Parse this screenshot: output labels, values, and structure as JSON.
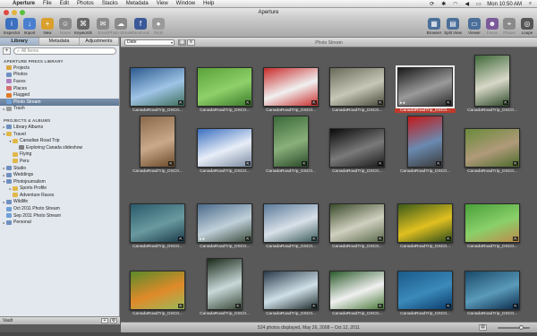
{
  "menubar": {
    "apple": "",
    "items": [
      "Aperture",
      "File",
      "Edit",
      "Photos",
      "Stacks",
      "Metadata",
      "View",
      "Window",
      "Help"
    ],
    "clock": "Mon 10:50 AM"
  },
  "window": {
    "title": "Aperture"
  },
  "toolbar": {
    "left": [
      {
        "label": "Inspector",
        "icon": "info-icon",
        "color": "#3b6fbf",
        "glyph": "i"
      },
      {
        "label": "Import",
        "icon": "import-icon",
        "color": "#4a7fd0",
        "glyph": "↓"
      },
      {
        "label": "New",
        "icon": "new-icon",
        "color": "#d9a02c",
        "glyph": "+"
      },
      {
        "label": "Name",
        "icon": "name-icon",
        "color": "#8a8a8a",
        "glyph": "☺",
        "dim": true
      },
      {
        "label": "Keywords",
        "icon": "keywords-icon",
        "color": "#666",
        "glyph": "⌘"
      },
      {
        "label": "Email",
        "icon": "email-icon",
        "color": "#8a8a8a",
        "glyph": "✉",
        "dim": true
      },
      {
        "label": "Photo Stream",
        "icon": "photo-stream-icon",
        "color": "#8a8a8a",
        "glyph": "☁",
        "dim": true
      },
      {
        "label": "Facebook",
        "icon": "facebook-icon",
        "color": "#3b5998",
        "glyph": "f",
        "dim": true
      },
      {
        "label": "Flickr",
        "icon": "flickr-icon",
        "color": "#9a9a9a",
        "glyph": "●",
        "dim": true
      }
    ],
    "right": [
      {
        "label": "Browser",
        "icon": "browser-icon",
        "color": "#4b6f99",
        "glyph": "▦"
      },
      {
        "label": "Split View",
        "icon": "split-view-icon",
        "color": "#4b6f99",
        "glyph": "▤"
      },
      {
        "label": "Viewer",
        "icon": "viewer-icon",
        "color": "#4b6f99",
        "glyph": "▭"
      },
      {
        "label": "Faces",
        "icon": "faces-icon",
        "color": "#7a5a99",
        "glyph": "☻",
        "dim": true
      },
      {
        "label": "Places",
        "icon": "places-icon",
        "color": "#8a8a8a",
        "glyph": "⌖",
        "dim": true
      },
      {
        "label": "Loupe",
        "icon": "loupe-icon",
        "color": "#555",
        "glyph": "◎"
      }
    ]
  },
  "inspector": {
    "tabs": [
      "Library",
      "Metadata",
      "Adjustments"
    ],
    "search_placeholder": "All Items",
    "library_heading": "APERTURE PRESS LIBRARY",
    "projects_heading": "PROJECTS & ALBUMS",
    "library_items": [
      {
        "label": "Projects",
        "color": "#d9a441"
      },
      {
        "label": "Photos",
        "color": "#6f8fbf"
      },
      {
        "label": "Faces",
        "color": "#b07fbf"
      },
      {
        "label": "Places",
        "color": "#d36f6f"
      },
      {
        "label": "Flagged",
        "color": "#e07a2a"
      },
      {
        "label": "Photo Stream",
        "color": "#6fa0d8",
        "selected": true
      },
      {
        "label": "Trash",
        "color": "#9a9a9a",
        "tri": "▸"
      }
    ],
    "project_items": [
      {
        "label": "Library Albums",
        "indent": 0,
        "tri": "▸",
        "color": "#6f8fbf"
      },
      {
        "label": "Travel",
        "indent": 0,
        "tri": "▾",
        "color": "#e0b84a"
      },
      {
        "label": "Canadian Road Trip",
        "indent": 1,
        "tri": "▾",
        "color": "#e0b84a"
      },
      {
        "label": "Exploring Canada slideshow",
        "indent": 2,
        "tri": "",
        "color": "#7f7f7f"
      },
      {
        "label": "Flying",
        "indent": 1,
        "tri": "",
        "color": "#e0b84a"
      },
      {
        "label": "Peru",
        "indent": 1,
        "tri": "",
        "color": "#e0b84a"
      },
      {
        "label": "Studio",
        "indent": 0,
        "tri": "▸",
        "color": "#6f8fbf"
      },
      {
        "label": "Weddings",
        "indent": 0,
        "tri": "▸",
        "color": "#6f8fbf"
      },
      {
        "label": "Photojournalism",
        "indent": 0,
        "tri": "▾",
        "color": "#6f8fbf"
      },
      {
        "label": "Sports Profile",
        "indent": 1,
        "tri": "▸",
        "color": "#e0b84a"
      },
      {
        "label": "Adventure Races",
        "indent": 1,
        "tri": "",
        "color": "#e0b84a"
      },
      {
        "label": "Wildlife",
        "indent": 0,
        "tri": "▸",
        "color": "#6f8fbf"
      },
      {
        "label": "Oct 2011 Photo Stream",
        "indent": 0,
        "tri": "",
        "color": "#6fa0d8"
      },
      {
        "label": "Sep 2011 Photo Stream",
        "indent": 0,
        "tri": "",
        "color": "#6fa0d8"
      },
      {
        "label": "Personal",
        "indent": 0,
        "tri": "▸",
        "color": "#6f8fbf"
      }
    ],
    "footer_label": "Vault"
  },
  "browser": {
    "sort_label": "Date",
    "title": "Photo Stream",
    "status": "524 photos displayed, May 26, 2008 – Oct 12, 2011",
    "photos": [
      {
        "caption": "CanadaRoadTrip_DSC0...",
        "colors": [
          "#2c5a8f",
          "#9fc4e6",
          "#3f6f5a"
        ],
        "row": 0,
        "col": 0,
        "w": 62,
        "h": 44
      },
      {
        "caption": "CanadaRoadTrip_DSC0...",
        "colors": [
          "#5aa23a",
          "#8fd06a",
          "#3a7a2a"
        ],
        "row": 0,
        "col": 1,
        "w": 62,
        "h": 44
      },
      {
        "caption": "CanadaRoadTrip_DSC0...",
        "colors": [
          "#c92b2b",
          "#f0f0f0",
          "#c92b2b"
        ],
        "row": 0,
        "col": 2,
        "w": 62,
        "h": 44
      },
      {
        "caption": "CanadaRoadTrip_DSC0...",
        "colors": [
          "#6a6a5a",
          "#c7c7b8",
          "#4a4a3a"
        ],
        "row": 0,
        "col": 3,
        "w": 62,
        "h": 44
      },
      {
        "caption": "CanadaRoadTrip_DSC0...",
        "colors": [
          "#1a1a1a",
          "#9a9a9a",
          "#2a2a2a"
        ],
        "row": 0,
        "col": 4,
        "w": 62,
        "h": 44,
        "selected": true,
        "stars": "★★"
      },
      {
        "caption": "CanadaRoadTrip_DSC0...",
        "colors": [
          "#3f6a3a",
          "#d8d8c8",
          "#2f4a2a"
        ],
        "row": 0,
        "col": 5,
        "w": 40,
        "h": 58
      },
      {
        "caption": "CanadaRoadTrip_DSC0...",
        "colors": [
          "#8a6a4a",
          "#c9a98a",
          "#6a4a2a"
        ],
        "row": 1,
        "col": 0,
        "w": 40,
        "h": 58
      },
      {
        "caption": "CanadaRoadTrip_DSC0...",
        "colors": [
          "#3a6fc0",
          "#e8eef8",
          "#7a8aa0"
        ],
        "row": 1,
        "col": 1,
        "w": 62,
        "h": 44
      },
      {
        "caption": "CanadaRoadTrip_DSC0...",
        "colors": [
          "#3a6a3a",
          "#8ab07a",
          "#2a4a2a"
        ],
        "row": 1,
        "col": 2,
        "w": 40,
        "h": 58
      },
      {
        "caption": "CanadaRoadTrip_DSC0...",
        "colors": [
          "#0a0a0a",
          "#7a7a7a",
          "#1a1a1a"
        ],
        "row": 1,
        "col": 3,
        "w": 62,
        "h": 44
      },
      {
        "caption": "CanadaRoadTrip_DSC0...",
        "colors": [
          "#c21a1a",
          "#6a8ab0",
          "#3a3a3a"
        ],
        "row": 1,
        "col": 4,
        "w": 40,
        "h": 58
      },
      {
        "caption": "CanadaRoadTrip_DSC0...",
        "colors": [
          "#6a8a3a",
          "#b09a7a",
          "#4a6a2a"
        ],
        "row": 1,
        "col": 5,
        "w": 62,
        "h": 44
      },
      {
        "caption": "CanadaRoadTrip_DSC0...",
        "colors": [
          "#2a5a6a",
          "#6a9aa0",
          "#1a3a4a"
        ],
        "row": 2,
        "col": 0,
        "w": 62,
        "h": 44
      },
      {
        "caption": "CanadaRoadTrip_DSC0...",
        "colors": [
          "#4a6a8a",
          "#c0d0da",
          "#3a4a3a"
        ],
        "row": 2,
        "col": 1,
        "w": 62,
        "h": 44,
        "stars": "★★"
      },
      {
        "caption": "CanadaRoadTrip_DSC0...",
        "colors": [
          "#5a7a9a",
          "#d8e0e8",
          "#3a5a5a"
        ],
        "row": 2,
        "col": 2,
        "w": 62,
        "h": 44
      },
      {
        "caption": "CanadaRoadTrip_DSC0...",
        "colors": [
          "#3a4a2a",
          "#d0d0c0",
          "#5a6a4a"
        ],
        "row": 2,
        "col": 3,
        "w": 62,
        "h": 44
      },
      {
        "caption": "CanadaRoadTrip_DSC0...",
        "colors": [
          "#3a5a1a",
          "#e0c020",
          "#2a4a1a"
        ],
        "row": 2,
        "col": 4,
        "w": 62,
        "h": 44
      },
      {
        "caption": "CanadaRoadTrip_DSC0...",
        "colors": [
          "#4aa03a",
          "#8ad06a",
          "#c08a4a"
        ],
        "row": 2,
        "col": 5,
        "w": 62,
        "h": 44
      },
      {
        "caption": "CanadaRoadTrip_DSC0...",
        "colors": [
          "#5a8a2a",
          "#e08a2a",
          "#9aba5a"
        ],
        "row": 3,
        "col": 0,
        "w": 62,
        "h": 44
      },
      {
        "caption": "CanadaRoadTrip_DSC0...",
        "colors": [
          "#1a2a1a",
          "#c8d8d8",
          "#3a4a3a"
        ],
        "row": 3,
        "col": 1,
        "w": 40,
        "h": 58
      },
      {
        "caption": "CanadaRoadTrip_DSC0...",
        "colors": [
          "#2a3a4a",
          "#d0e0e8",
          "#1a2a2a"
        ],
        "row": 3,
        "col": 2,
        "w": 62,
        "h": 44
      },
      {
        "caption": "CanadaRoadTrip_DSC0...",
        "colors": [
          "#2a5a2a",
          "#f0f0f0",
          "#4a7a3a"
        ],
        "row": 3,
        "col": 3,
        "w": 62,
        "h": 44
      },
      {
        "caption": "CanadaRoadTrip_DSC0...",
        "colors": [
          "#1a5a8a",
          "#3a8aba",
          "#0a3a6a"
        ],
        "row": 3,
        "col": 4,
        "w": 62,
        "h": 44
      },
      {
        "caption": "CanadaRoadTrip_DSC0...",
        "colors": [
          "#1a4a6a",
          "#5a9aba",
          "#0a2a4a"
        ],
        "row": 3,
        "col": 5,
        "w": 62,
        "h": 44
      }
    ]
  }
}
